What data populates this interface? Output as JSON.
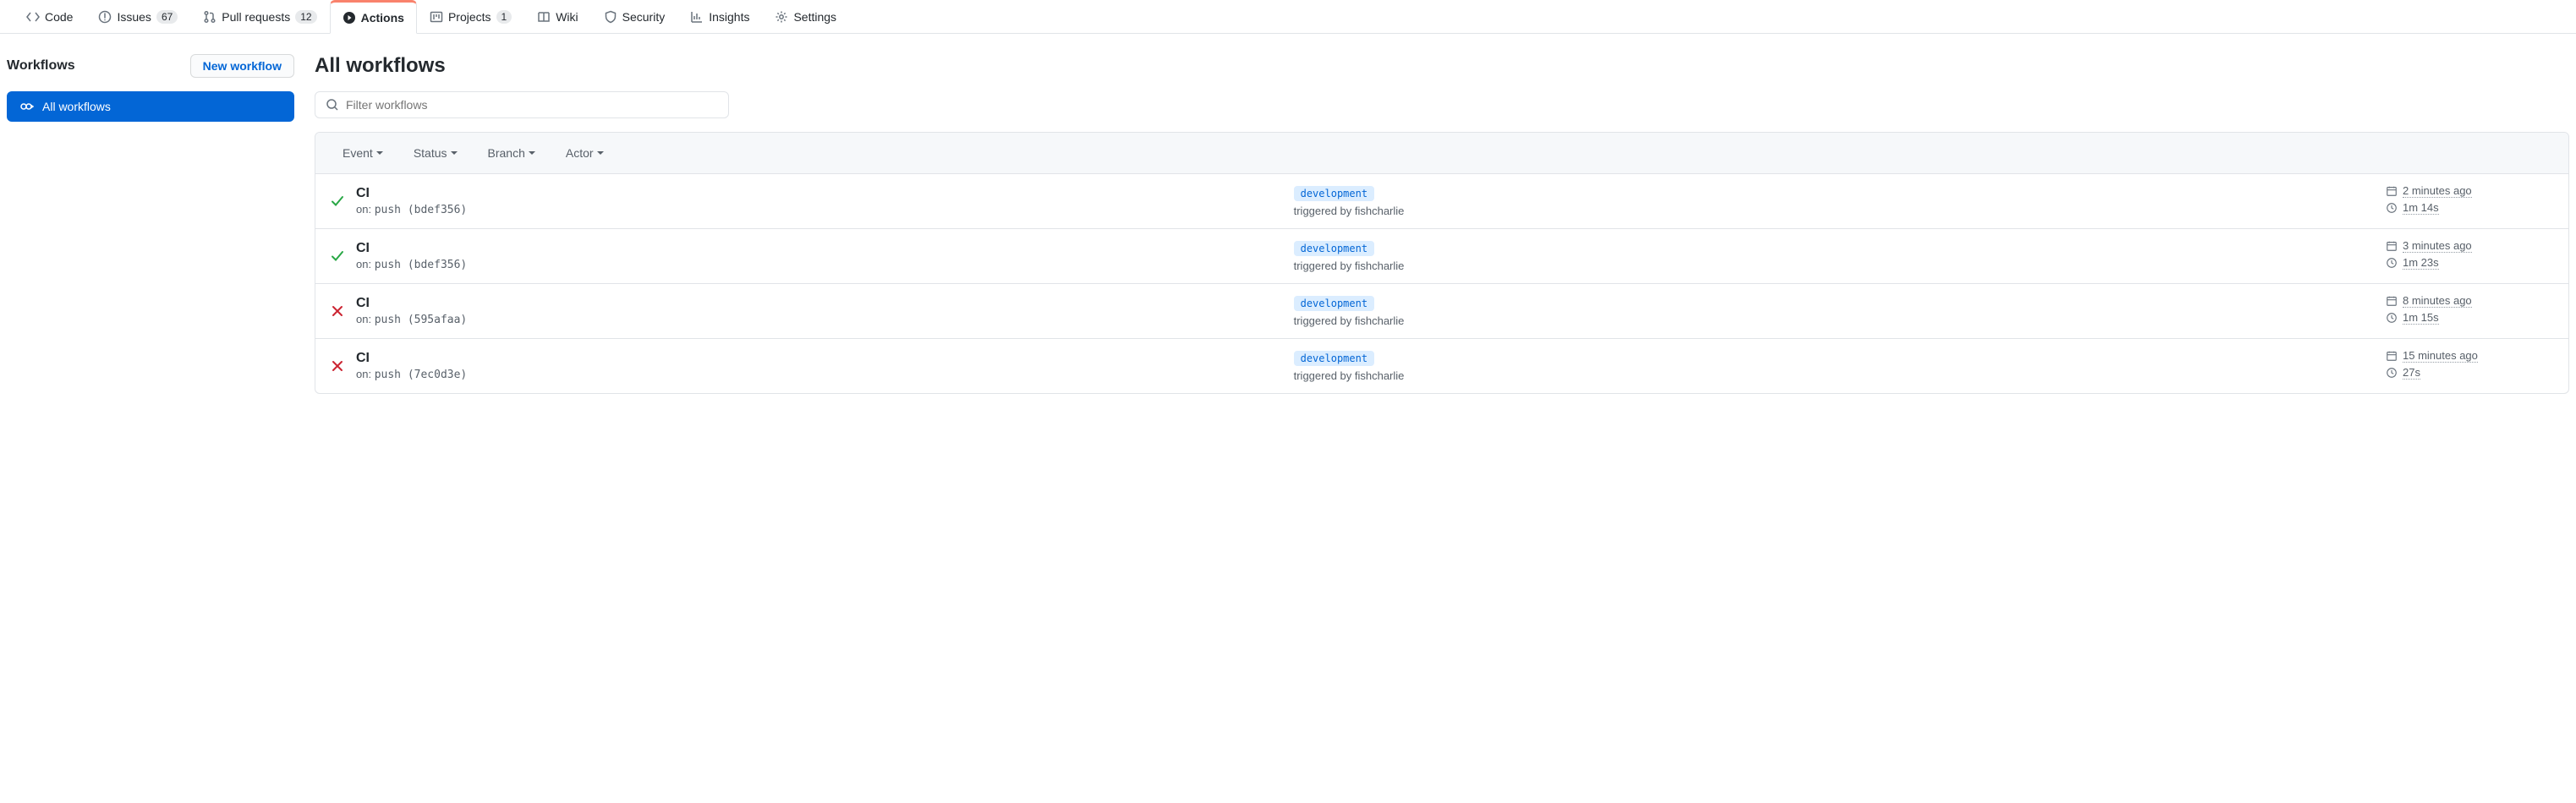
{
  "tabs": [
    {
      "icon": "code",
      "label": "Code",
      "count": null
    },
    {
      "icon": "issue",
      "label": "Issues",
      "count": "67"
    },
    {
      "icon": "pr",
      "label": "Pull requests",
      "count": "12"
    },
    {
      "icon": "play",
      "label": "Actions",
      "count": null,
      "active": true
    },
    {
      "icon": "project",
      "label": "Projects",
      "count": "1"
    },
    {
      "icon": "wiki",
      "label": "Wiki",
      "count": null
    },
    {
      "icon": "shield",
      "label": "Security",
      "count": null
    },
    {
      "icon": "graph",
      "label": "Insights",
      "count": null
    },
    {
      "icon": "gear",
      "label": "Settings",
      "count": null
    }
  ],
  "sidebar": {
    "title": "Workflows",
    "new_btn": "New workflow",
    "all_item": "All workflows"
  },
  "main": {
    "heading": "All workflows",
    "filter_placeholder": "Filter workflows",
    "filters": [
      "Event",
      "Status",
      "Branch",
      "Actor"
    ]
  },
  "runs": [
    {
      "status": "success",
      "title": "CI",
      "on_prefix": "on: ",
      "event": "push",
      "sha": "(bdef356)",
      "branch": "development",
      "trigger": "triggered by fishcharlie",
      "time": "2 minutes ago",
      "duration": "1m 14s"
    },
    {
      "status": "success",
      "title": "CI",
      "on_prefix": "on: ",
      "event": "push",
      "sha": "(bdef356)",
      "branch": "development",
      "trigger": "triggered by fishcharlie",
      "time": "3 minutes ago",
      "duration": "1m 23s"
    },
    {
      "status": "failure",
      "title": "CI",
      "on_prefix": "on: ",
      "event": "push",
      "sha": "(595afaa)",
      "branch": "development",
      "trigger": "triggered by fishcharlie",
      "time": "8 minutes ago",
      "duration": "1m 15s"
    },
    {
      "status": "failure",
      "title": "CI",
      "on_prefix": "on: ",
      "event": "push",
      "sha": "(7ec0d3e)",
      "branch": "development",
      "trigger": "triggered by fishcharlie",
      "time": "15 minutes ago",
      "duration": "27s"
    }
  ]
}
